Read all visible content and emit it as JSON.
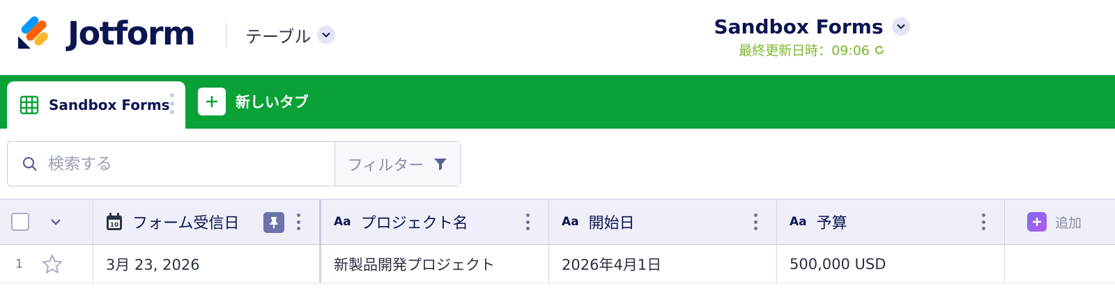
{
  "header": {
    "brand": "Jotform",
    "view_label": "テーブル",
    "title": "Sandbox Forms",
    "last_updated": "最終更新日時：09:06"
  },
  "tabs": {
    "active_label": "Sandbox Forms",
    "new_tab_label": "新しいタブ"
  },
  "search": {
    "placeholder": "検索する",
    "value": "",
    "filter_label": "フィルター"
  },
  "table": {
    "columns": [
      {
        "label": "フォーム受信日",
        "type_icon": "calendar-icon"
      },
      {
        "label": "プロジェクト名",
        "type_icon": "Aa"
      },
      {
        "label": "開始日",
        "type_icon": "Aa"
      },
      {
        "label": "予算",
        "type_icon": "Aa"
      }
    ],
    "add_label": "追加",
    "rows": [
      {
        "num": "1",
        "cells": [
          "3月 23, 2026",
          "新製品開発プロジェクト",
          "2026年4月1日",
          "500,000 USD"
        ]
      }
    ]
  },
  "colors": {
    "brand_navy": "#0a1551",
    "tabbar_green": "#0aa137",
    "updated_green": "#7cb82f",
    "header_row_bg": "#eeeff9"
  }
}
